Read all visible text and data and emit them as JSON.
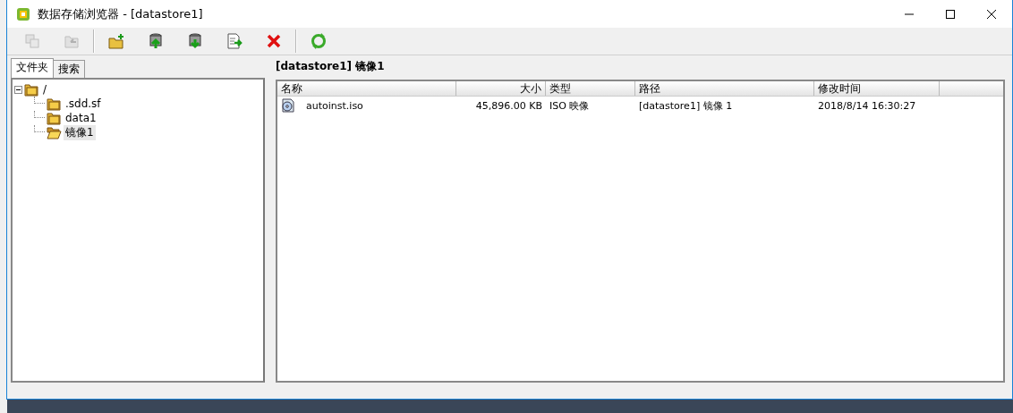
{
  "window": {
    "title": "数据存储浏览器 - [datastore1]"
  },
  "toolbar": [
    {
      "kind": "copy",
      "disabled": true
    },
    {
      "kind": "move",
      "disabled": true
    },
    {
      "kind": "sep"
    },
    {
      "kind": "new-folder",
      "disabled": false
    },
    {
      "kind": "upload",
      "disabled": false
    },
    {
      "kind": "download",
      "disabled": false
    },
    {
      "kind": "export",
      "disabled": false
    },
    {
      "kind": "delete",
      "disabled": false
    },
    {
      "kind": "sep"
    },
    {
      "kind": "refresh",
      "disabled": false
    }
  ],
  "tabs": [
    {
      "label": "文件夹",
      "selected": true
    },
    {
      "label": "搜索",
      "selected": false
    }
  ],
  "tree": [
    {
      "label": "/",
      "expanded": true,
      "selected": false,
      "children": [
        {
          "label": ".sdd.sf",
          "selected": false
        },
        {
          "label": "data1",
          "selected": false
        },
        {
          "label": "镜像1",
          "selected": true
        }
      ]
    }
  ],
  "path_title": "[datastore1] 镜像1",
  "table": {
    "columns": [
      {
        "label": "名称",
        "kind": "text"
      },
      {
        "label": "大小",
        "kind": "number"
      },
      {
        "label": "类型",
        "kind": "text"
      },
      {
        "label": "路径",
        "kind": "text"
      },
      {
        "label": "修改时间",
        "kind": "text"
      }
    ],
    "rows": [
      {
        "kind": "iso",
        "cells": [
          "autoinst.iso",
          "45,896.00 KB",
          "ISO 映像",
          "[datastore1] 镜像 1",
          "2018/8/14 16:30:27"
        ],
        "selected": false
      }
    ]
  }
}
